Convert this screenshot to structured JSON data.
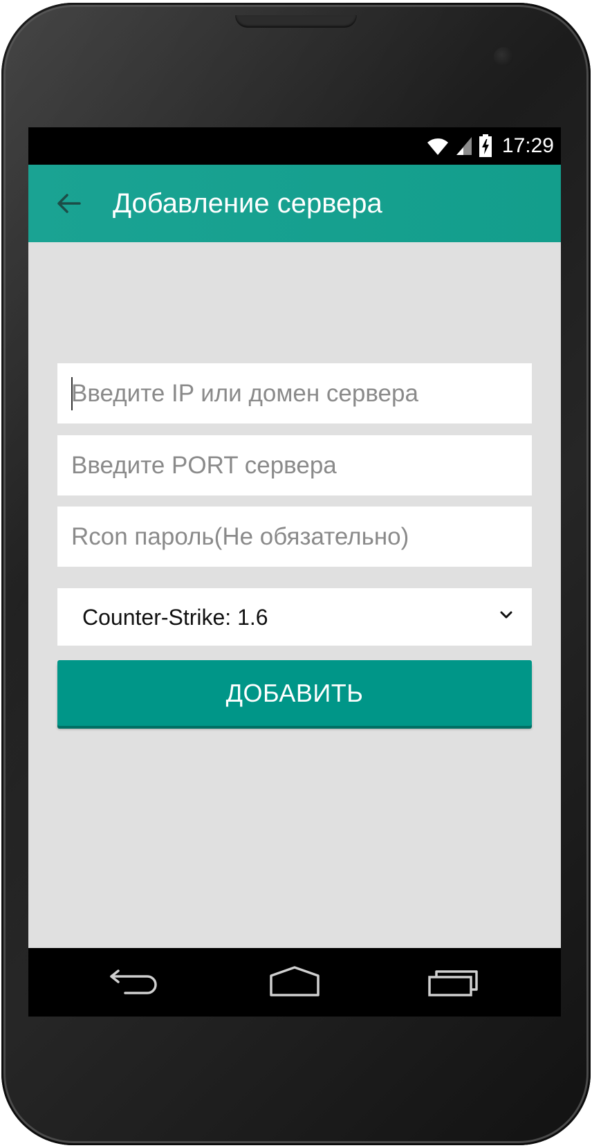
{
  "status_bar": {
    "time": "17:29",
    "icons": [
      "wifi-icon",
      "signal-icon",
      "battery-charging-icon"
    ]
  },
  "app_bar": {
    "back_icon": "arrow-back-icon",
    "title": "Добавление сервера"
  },
  "form": {
    "ip_field": {
      "value": "",
      "placeholder": "Введите IP или домен сервера"
    },
    "port_field": {
      "value": "",
      "placeholder": "Введите PORT сервера"
    },
    "rcon_field": {
      "value": "",
      "placeholder": "Rcon пароль(Не обязательно)"
    },
    "game_select": {
      "selected": "Counter-Strike: 1.6",
      "icon": "chevron-down-icon"
    },
    "submit_label": "ДОБАВИТЬ"
  },
  "nav_bar": {
    "buttons": [
      "back-nav-icon",
      "home-nav-icon",
      "recent-apps-icon"
    ]
  },
  "colors": {
    "primary": "#009688",
    "app_bar": "#139e8c",
    "background": "#e0e0e0",
    "placeholder": "#8a8a8a"
  }
}
